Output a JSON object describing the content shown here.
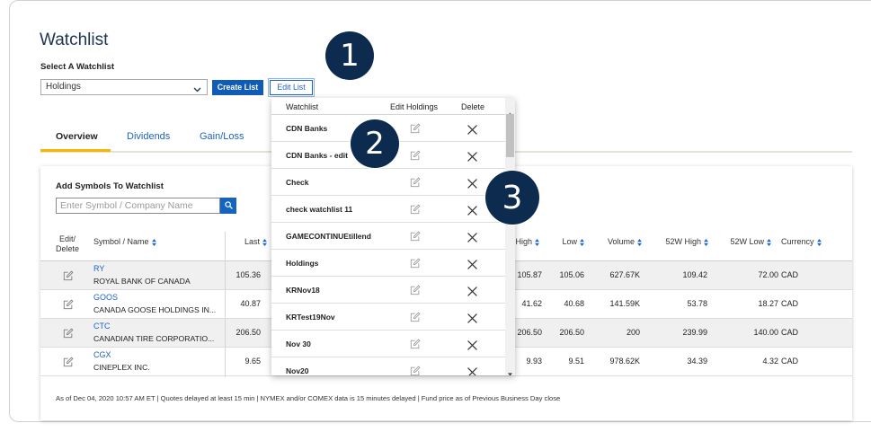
{
  "page": {
    "title": "Watchlist",
    "select_label": "Select A Watchlist",
    "selected_watchlist": "Holdings",
    "create_list_label": "Create List",
    "edit_list_label": "Edit List"
  },
  "tabs": [
    {
      "label": "Overview",
      "active": true
    },
    {
      "label": "Dividends",
      "active": false
    },
    {
      "label": "Gain/Loss",
      "active": false
    }
  ],
  "add_symbols": {
    "title": "Add Symbols To Watchlist",
    "placeholder": "Enter Symbol / Company Name"
  },
  "table": {
    "headers": {
      "edit_delete": [
        "Edit/",
        "Delete"
      ],
      "symbol_name": "Symbol / Name",
      "last": "Last",
      "high": "High",
      "low": "Low",
      "volume": "Volume",
      "w52_high": "52W High",
      "w52_low": "52W Low",
      "currency": "Currency"
    },
    "rows": [
      {
        "symbol": "RY",
        "name": "ROYAL BANK OF CANADA",
        "last": "105.36",
        "high": "105.87",
        "low": "105.06",
        "volume": "627.67K",
        "w52_high": "109.42",
        "w52_low": "72.00",
        "currency": "CAD"
      },
      {
        "symbol": "GOOS",
        "name": "CANADA GOOSE HOLDINGS IN...",
        "last": "40.87",
        "high": "41.62",
        "low": "40.68",
        "volume": "141.59K",
        "w52_high": "53.78",
        "w52_low": "18.27",
        "currency": "CAD"
      },
      {
        "symbol": "CTC",
        "name": "CANADIAN TIRE CORPORATIO...",
        "last": "206.50",
        "high": "206.50",
        "low": "206.50",
        "volume": "200",
        "w52_high": "239.99",
        "w52_low": "140.00",
        "currency": "CAD"
      },
      {
        "symbol": "CGX",
        "name": "CINEPLEX INC.",
        "last": "9.65",
        "high": "9.93",
        "low": "9.51",
        "volume": "978.62K",
        "w52_high": "34.39",
        "w52_low": "4.32",
        "currency": "CAD"
      }
    ]
  },
  "footer_note": "As of Dec 04, 2020 10:57 AM ET | Quotes delayed at least 15 min | NYMEX and/or COMEX data is 15 minutes delayed | Fund price as of Previous Business Day close",
  "watchlist_dropdown": {
    "headers": {
      "watchlist": "Watchlist",
      "edit_holdings": "Edit Holdings",
      "delete": "Delete"
    },
    "items": [
      "CDN Banks",
      "CDN Banks - edit",
      "Check",
      "check watchlist 11",
      "GAMECONTINUEtillend",
      "Holdings",
      "KRNov18",
      "KRTest19Nov",
      "Nov 30",
      "Nov20"
    ]
  },
  "callouts": [
    "1",
    "2",
    "3"
  ],
  "icons": {
    "select": "chevron-down-icon",
    "search": "search-icon",
    "edit": "edit-pencil-icon",
    "delete": "delete-x-icon",
    "sort": "sort-icon",
    "scroll_up": "scroll-up-arrow-icon",
    "scroll_down": "scroll-down-arrow-icon"
  },
  "colors": {
    "title_navy": "#1d3354",
    "accent_blue": "#1c63c6",
    "button_blue": "#0f5bb5",
    "active_tab_underline": "#f2b705",
    "callout_navy": "#0c2b4e",
    "row_stripe": "#f0f0f0"
  }
}
